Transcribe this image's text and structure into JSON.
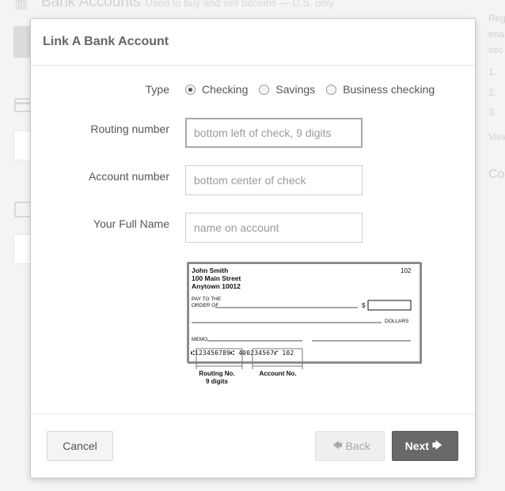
{
  "background": {
    "title": "Bank Accounts",
    "subtitle": "Used to buy and sell bitcoins — U.S. only",
    "right_text_1": "Reg",
    "right_text_2": "ena",
    "right_text_3": "sec",
    "right_list_1": "1.",
    "right_list_2": "2.",
    "right_list_3": "3.",
    "right_link": "View",
    "right_heading": "Co"
  },
  "modal": {
    "title": "Link A Bank Account",
    "type_label": "Type",
    "type_options": [
      {
        "label": "Checking",
        "selected": true
      },
      {
        "label": "Savings",
        "selected": false
      },
      {
        "label": "Business checking",
        "selected": false
      }
    ],
    "routing_label": "Routing number",
    "routing_placeholder": "bottom left of check, 9 digits",
    "account_label": "Account number",
    "account_placeholder": "bottom center of check",
    "name_label": "Your Full Name",
    "name_placeholder": "name on account",
    "check": {
      "name": "John Smith",
      "street": "100 Main Street",
      "city": "Anytown 10012",
      "number": "102",
      "pay_to_1": "PAY TO THE",
      "pay_to_2": "ORDER OF",
      "dollar_sign": "$",
      "dollars": "DOLLARS",
      "memo": "MEMO",
      "micr": "⑆123456789⑆  400234567⑈  102",
      "routing_caption_1": "Routing No.",
      "routing_caption_2": "9 digits",
      "account_caption": "Account No."
    },
    "buttons": {
      "cancel": "Cancel",
      "back": "Back",
      "next": "Next"
    }
  }
}
